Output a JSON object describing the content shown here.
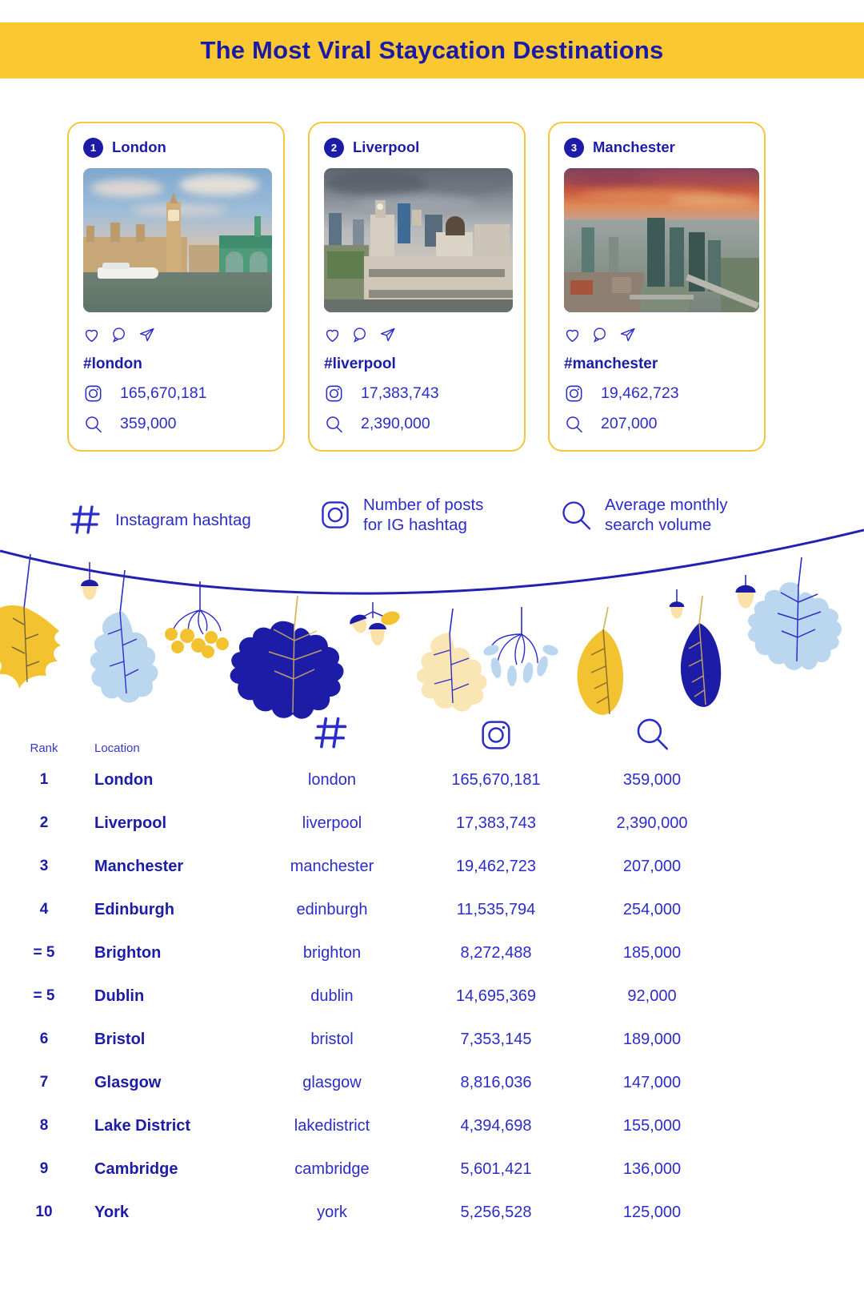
{
  "header": {
    "title": "The Most Viral Staycation Destinations",
    "banner_color": "#FBC832",
    "title_color": "#1A1AA8"
  },
  "cards": [
    {
      "rank": "1",
      "city": "London",
      "hashtag": "#london",
      "posts": "165,670,181",
      "searches": "359,000",
      "photo_alt": "Houses of Parliament, Big Ben and Westminster Bridge over the River Thames"
    },
    {
      "rank": "2",
      "city": "Liverpool",
      "hashtag": "#liverpool",
      "posts": "17,383,743",
      "searches": "2,390,000",
      "photo_alt": "Liverpool waterfront Three Graces under cloudy sky"
    },
    {
      "rank": "3",
      "city": "Manchester",
      "hashtag": "#manchester",
      "posts": "19,462,723",
      "searches": "207,000",
      "photo_alt": "Manchester skyline with Deansgate towers at sunset"
    }
  ],
  "legend": [
    {
      "icon": "hashtag-icon",
      "text": "Instagram hashtag"
    },
    {
      "icon": "instagram-icon",
      "line1": "Number of posts",
      "line2": "for IG hashtag"
    },
    {
      "icon": "search-icon",
      "line1": "Average monthly",
      "line2": "search volume"
    }
  ],
  "table": {
    "headers": {
      "rank": "Rank",
      "location": "Location",
      "hashtag_icon": "hashtag-icon",
      "posts_icon": "instagram-icon",
      "search_icon": "search-icon"
    },
    "rows": [
      {
        "rank": "1",
        "location": "London",
        "hashtag": "london",
        "posts": "165,670,181",
        "searches": "359,000"
      },
      {
        "rank": "2",
        "location": "Liverpool",
        "hashtag": "liverpool",
        "posts": "17,383,743",
        "searches": "2,390,000"
      },
      {
        "rank": "3",
        "location": "Manchester",
        "hashtag": "manchester",
        "posts": "19,462,723",
        "searches": "207,000"
      },
      {
        "rank": "4",
        "location": "Edinburgh",
        "hashtag": "edinburgh",
        "posts": "11,535,794",
        "searches": "254,000"
      },
      {
        "rank": "= 5",
        "location": "Brighton",
        "hashtag": "brighton",
        "posts": "8,272,488",
        "searches": "185,000"
      },
      {
        "rank": "= 5",
        "location": "Dublin",
        "hashtag": "dublin",
        "posts": "14,695,369",
        "searches": "92,000"
      },
      {
        "rank": "6",
        "location": "Bristol",
        "hashtag": "bristol",
        "posts": "7,353,145",
        "searches": "189,000"
      },
      {
        "rank": "7",
        "location": "Glasgow",
        "hashtag": "glasgow",
        "posts": "8,816,036",
        "searches": "147,000"
      },
      {
        "rank": "8",
        "location": "Lake District",
        "hashtag": "lakedistrict",
        "posts": "4,394,698",
        "searches": "155,000"
      },
      {
        "rank": "9",
        "location": "Cambridge",
        "hashtag": "cambridge",
        "posts": "5,601,421",
        "searches": "136,000"
      },
      {
        "rank": "10",
        "location": "York",
        "hashtag": "york",
        "posts": "5,256,528",
        "searches": "125,000"
      }
    ]
  },
  "colors": {
    "brand_blue": "#1C1CA6",
    "text_blue": "#2C2CC9",
    "accent_yellow": "#F5C63C",
    "banner_yellow": "#FBC832",
    "light_blue": "#BBD7F0",
    "cream": "#FAE6B4"
  }
}
